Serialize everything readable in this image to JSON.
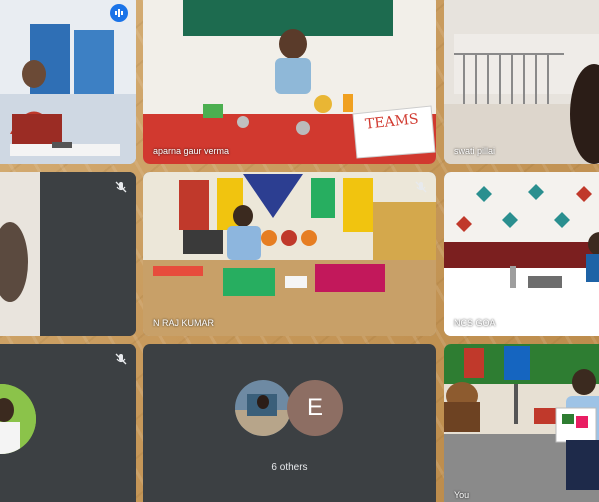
{
  "meeting": {
    "participants": [
      {
        "id": "host",
        "name": "",
        "muted": false,
        "speaking": true
      },
      {
        "id": "p2",
        "name": "aparna gaur verma",
        "muted": false
      },
      {
        "id": "p3",
        "name": "swati pillai",
        "muted": false
      },
      {
        "id": "p4",
        "name": "",
        "muted": true
      },
      {
        "id": "p5",
        "name": "N RAJ KUMAR",
        "muted": true
      },
      {
        "id": "p6",
        "name": "NCS GOA",
        "muted": false
      },
      {
        "id": "p7",
        "name": "",
        "muted": true
      },
      {
        "id": "you",
        "name": "You",
        "muted": false
      }
    ],
    "others": {
      "initial": "E",
      "label": "6 others",
      "avatar_color": "#8d6e63"
    },
    "sign_text": "TEAMS"
  },
  "theme": {
    "tile_background": "#3c4043",
    "active_speaker_border": "#8ab4f8",
    "speaking_badge": "#1a73e8"
  },
  "icons": {
    "speaking": "audio-bars-icon",
    "muted": "mic-off-icon"
  }
}
